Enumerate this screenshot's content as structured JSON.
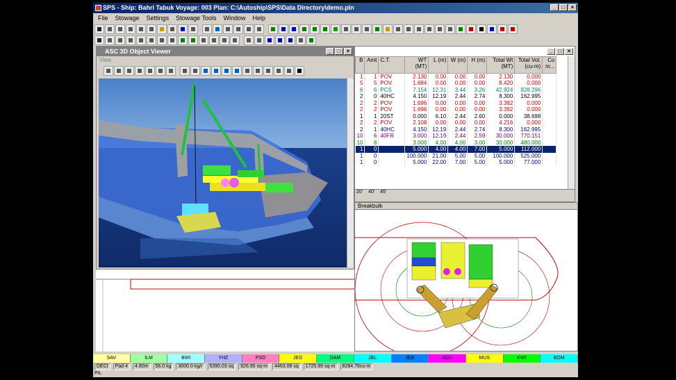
{
  "window": {
    "title": "SPS - Ship: Bahri Tabuk    Voyage: 003    Plan: C:\\Autoship\\SPS\\Data Directory\\demo.pln"
  },
  "menu": [
    "File",
    "Stowage",
    "Settings",
    "Stowage Tools",
    "Window",
    "Help"
  ],
  "viewer": {
    "title": "ASC 3D Object Viewer",
    "menu_label": "View"
  },
  "grid": {
    "columns": [
      "B",
      "Amt",
      "C.T.",
      "WT (MT)",
      "L (m)",
      "W (m)",
      "H (m)",
      "Total Wt (MT)",
      "Total Vol. (cu-m)",
      "Co m..."
    ],
    "rows": [
      {
        "b": "1",
        "amt": "1",
        "ct": "POV",
        "wt": "2.130",
        "l": "0.00",
        "w": "0.00",
        "h": "0.00",
        "twt": "2.130",
        "tvol": "0.000",
        "color": "#cc0000"
      },
      {
        "b": "5",
        "amt": "5",
        "ct": "POV",
        "wt": "1.684",
        "l": "0.00",
        "w": "0.00",
        "h": "0.00",
        "twt": "8.420",
        "tvol": "0.000",
        "color": "#cc0000"
      },
      {
        "b": "6",
        "amt": "6",
        "ct": "PCS",
        "wt": "7.154",
        "l": "12.31",
        "w": "3.44",
        "h": "3.26",
        "twt": "42.924",
        "tvol": "828.296",
        "color": "#008080"
      },
      {
        "b": "2",
        "amt": "0",
        "ct": "40HC",
        "wt": "4.150",
        "l": "12.19",
        "w": "2.44",
        "h": "2.74",
        "twt": "8.300",
        "tvol": "162.995",
        "color": "#000000"
      },
      {
        "b": "2",
        "amt": "2",
        "ct": "POV",
        "wt": "1.696",
        "l": "0.00",
        "w": "0.00",
        "h": "0.00",
        "twt": "3.392",
        "tvol": "0.000",
        "color": "#cc0000"
      },
      {
        "b": "2",
        "amt": "2",
        "ct": "POV",
        "wt": "1.696",
        "l": "0.00",
        "w": "0.00",
        "h": "0.00",
        "twt": "3.392",
        "tvol": "0.000",
        "color": "#cc0000"
      },
      {
        "b": "1",
        "amt": "1",
        "ct": "20ST",
        "wt": "0.000",
        "l": "6.10",
        "w": "2.44",
        "h": "2.60",
        "twt": "0.000",
        "tvol": "38.698",
        "color": "#000000"
      },
      {
        "b": "2",
        "amt": "2",
        "ct": "POV",
        "wt": "2.108",
        "l": "0.00",
        "w": "0.00",
        "h": "0.00",
        "twt": "4.216",
        "tvol": "0.000",
        "color": "#cc0000"
      },
      {
        "b": "2",
        "amt": "1",
        "ct": "40HC",
        "wt": "4.150",
        "l": "12.19",
        "w": "2.44",
        "h": "2.74",
        "twt": "8.300",
        "tvol": "162.995",
        "color": "#000080"
      },
      {
        "b": "10",
        "amt": "6",
        "ct": "40FR",
        "wt": "3.000",
        "l": "12.19",
        "w": "2.44",
        "h": "2.59",
        "twt": "30.000",
        "tvol": "770.151",
        "color": "#800080"
      },
      {
        "b": "10",
        "amt": "8",
        "ct": "",
        "wt": "3.000",
        "l": "4.00",
        "w": "4.00",
        "h": "3.00",
        "twt": "30.000",
        "tvol": "480.000",
        "color": "#008000"
      },
      {
        "b": "1",
        "amt": "0",
        "ct": "",
        "wt": "5.000",
        "l": "4.00",
        "w": "4.00",
        "h": "7.00",
        "twt": "5.000",
        "tvol": "112.000",
        "color": "#ffffff",
        "selected": true
      },
      {
        "b": "1",
        "amt": "0",
        "ct": "",
        "wt": "100.000",
        "l": "21.00",
        "w": "5.00",
        "h": "5.00",
        "twt": "100.000",
        "tvol": "525.000",
        "color": "#000080"
      },
      {
        "b": "1",
        "amt": "0",
        "ct": "",
        "wt": "5.000",
        "l": "22.00",
        "w": "7.00",
        "h": "5.00",
        "twt": "5.000",
        "tvol": "77.000",
        "color": "#000080"
      }
    ],
    "footer_labels": [
      "20'",
      "40'",
      "45'"
    ],
    "cargo_type": "Breakbulk"
  },
  "ports": [
    {
      "label": "SAV",
      "color": "#ffffa0"
    },
    {
      "label": "ILM",
      "color": "#a0ffa0"
    },
    {
      "label": "BWI",
      "color": "#a0ffff"
    },
    {
      "label": "YHZ",
      "color": "#b0b0ff"
    },
    {
      "label": "PSD",
      "color": "#ff80c0"
    },
    {
      "label": "JED",
      "color": "#ffff00"
    },
    {
      "label": "DAM",
      "color": "#00ff80"
    },
    {
      "label": "JBL",
      "color": "#00ffff"
    },
    {
      "label": "JEB",
      "color": "#0080ff"
    },
    {
      "label": "ADU",
      "color": "#ff00ff"
    },
    {
      "label": "MUS",
      "color": "#ffff00"
    },
    {
      "label": "KWI",
      "color": "#00ff00"
    },
    {
      "label": "BOM",
      "color": "#00ffff"
    }
  ],
  "status": {
    "deck": "DECI",
    "pad": "Pad 4",
    "height": "4.80m",
    "weight": "56.0 kg",
    "pressure": "3000.0 kg/r",
    "area1": "5390.03 sq",
    "area2": "926.95 sq-m",
    "area3": "4463.08 sq",
    "area4": "1725.99 sq-m",
    "volume": "8284.76cu-m",
    "mode": "PIL"
  }
}
